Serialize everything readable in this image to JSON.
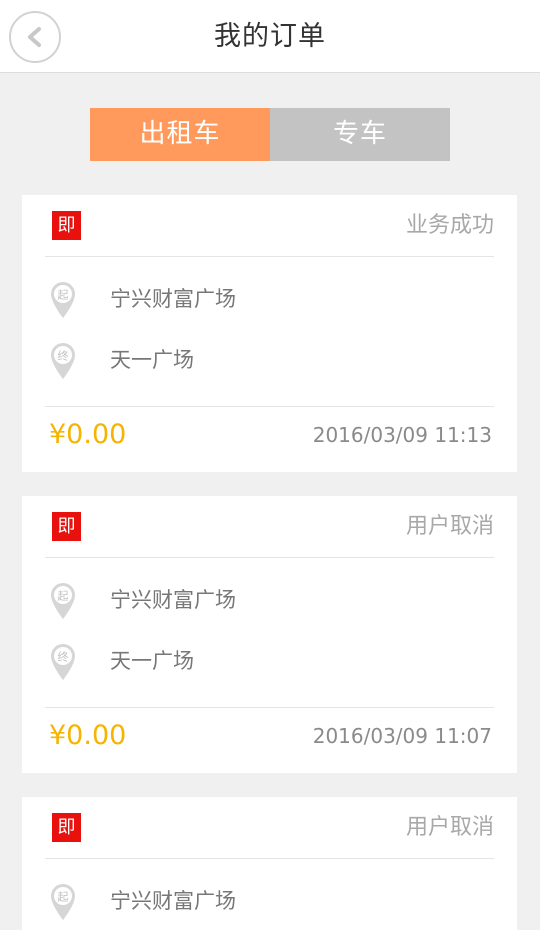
{
  "header": {
    "title": "我的订单",
    "back_icon": "chevron-left-icon"
  },
  "tabs": [
    {
      "label": "出租车",
      "active": true
    },
    {
      "label": "专车",
      "active": false
    }
  ],
  "orders": [
    {
      "badge": "即",
      "status": "业务成功",
      "start_pin": "起",
      "start": "宁兴财富广场",
      "end_pin": "终",
      "end": "天一广场",
      "price": "¥0.00",
      "time": "2016/03/09 11:13"
    },
    {
      "badge": "即",
      "status": "用户取消",
      "start_pin": "起",
      "start": "宁兴财富广场",
      "end_pin": "终",
      "end": "天一广场",
      "price": "¥0.00",
      "time": "2016/03/09 11:07"
    },
    {
      "badge": "即",
      "status": "用户取消",
      "start_pin": "起",
      "start": "宁兴财富广场"
    }
  ],
  "colors": {
    "accent": "#ff9a5c",
    "tab_inactive": "#c3c3c3",
    "badge": "#e8110d",
    "price": "#f5b400"
  }
}
